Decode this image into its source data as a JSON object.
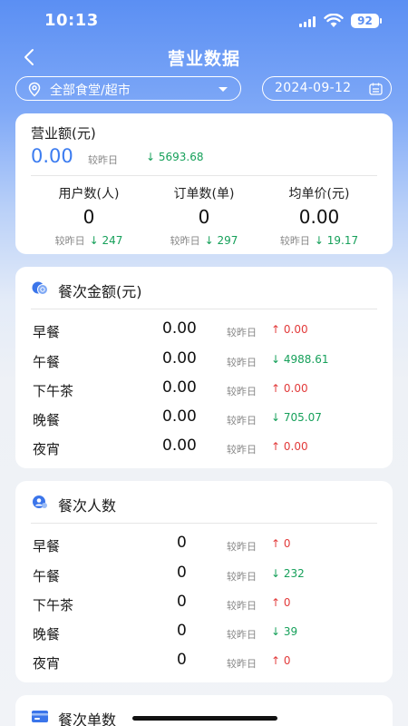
{
  "status_bar": {
    "time": "10:13",
    "battery": "92"
  },
  "nav": {
    "title": "营业数据"
  },
  "filters": {
    "canteen": "全部食堂/超市",
    "date": "2024-09-12"
  },
  "summary": {
    "revenue_label": "营业额(元)",
    "revenue_value": "0.00",
    "compare_label": "较昨日",
    "revenue_delta": "5693.68",
    "metrics": [
      {
        "label": "用户数(人)",
        "value": "0",
        "delta": "247",
        "direction": "down"
      },
      {
        "label": "订单数(单)",
        "value": "0",
        "delta": "297",
        "direction": "down"
      },
      {
        "label": "均单价(元)",
        "value": "0.00",
        "delta": "19.17",
        "direction": "down"
      }
    ]
  },
  "meal_amount": {
    "title": "餐次金额(元)",
    "rows": [
      {
        "label": "早餐",
        "value": "0.00",
        "compare": "较昨日",
        "delta": "0.00",
        "direction": "up"
      },
      {
        "label": "午餐",
        "value": "0.00",
        "compare": "较昨日",
        "delta": "4988.61",
        "direction": "down"
      },
      {
        "label": "下午茶",
        "value": "0.00",
        "compare": "较昨日",
        "delta": "0.00",
        "direction": "up"
      },
      {
        "label": "晚餐",
        "value": "0.00",
        "compare": "较昨日",
        "delta": "705.07",
        "direction": "down"
      },
      {
        "label": "夜宵",
        "value": "0.00",
        "compare": "较昨日",
        "delta": "0.00",
        "direction": "up"
      }
    ]
  },
  "meal_people": {
    "title": "餐次人数",
    "rows": [
      {
        "label": "早餐",
        "value": "0",
        "compare": "较昨日",
        "delta": "0",
        "direction": "up"
      },
      {
        "label": "午餐",
        "value": "0",
        "compare": "较昨日",
        "delta": "232",
        "direction": "down"
      },
      {
        "label": "下午茶",
        "value": "0",
        "compare": "较昨日",
        "delta": "0",
        "direction": "up"
      },
      {
        "label": "晚餐",
        "value": "0",
        "compare": "较昨日",
        "delta": "39",
        "direction": "down"
      },
      {
        "label": "夜宵",
        "value": "0",
        "compare": "较昨日",
        "delta": "0",
        "direction": "up"
      }
    ]
  },
  "meal_orders": {
    "title": "餐次单数"
  },
  "colors": {
    "accent": "#3c7cf0",
    "down": "#16a05a",
    "up": "#e23b3b"
  },
  "icons": [
    "back-icon",
    "location-icon",
    "calendar-icon",
    "coins-icon",
    "people-icon",
    "orders-icon"
  ]
}
